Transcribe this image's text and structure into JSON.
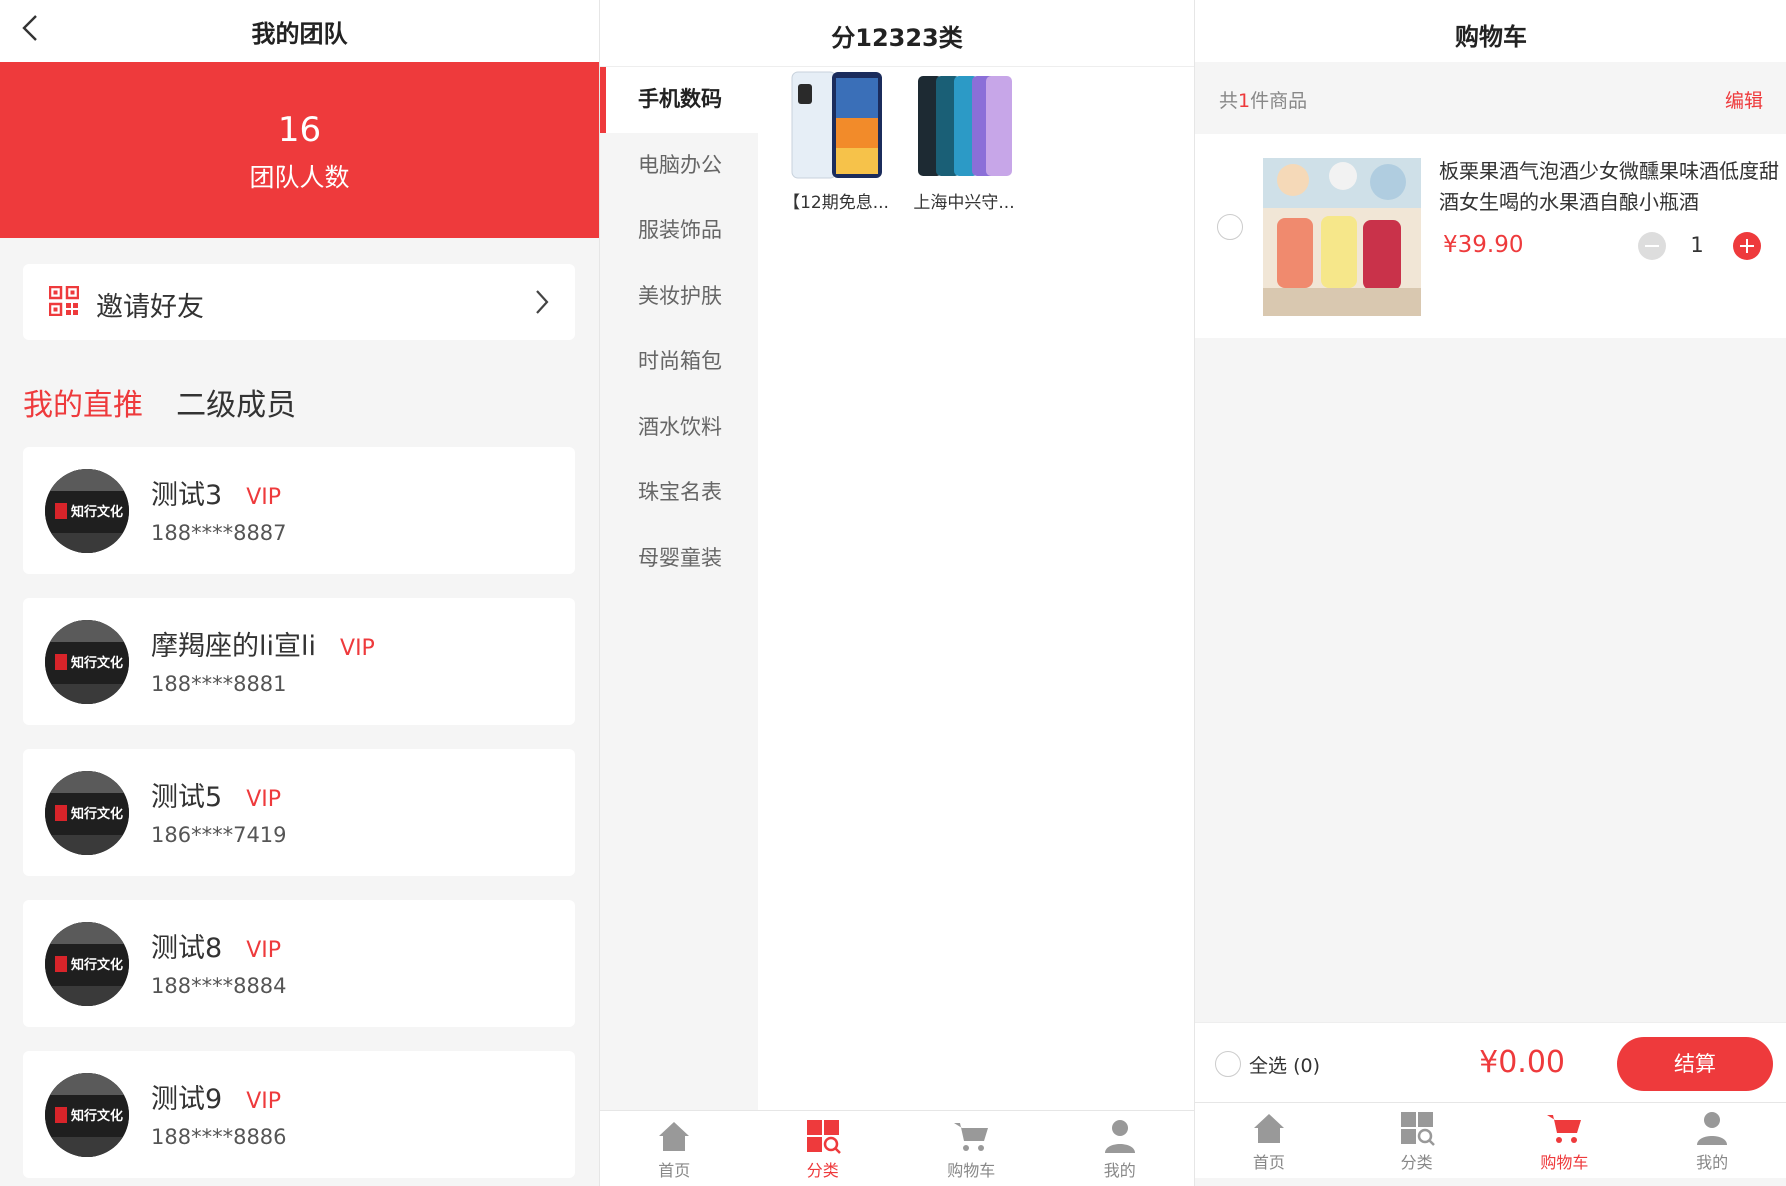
{
  "team": {
    "title": "我的团队",
    "count": "16",
    "count_label": "团队人数",
    "invite_label": "邀请好友",
    "tabs": [
      {
        "label": "我的直推",
        "active": true
      },
      {
        "label": "二级成员",
        "active": false
      }
    ],
    "vip_label": "VIP",
    "avatar_text": "知行文化",
    "members": [
      {
        "name": "测试3",
        "phone": "188****8887"
      },
      {
        "name": "摩羯座的li宣li",
        "phone": "188****8881"
      },
      {
        "name": "测试5",
        "phone": "186****7419"
      },
      {
        "name": "测试8",
        "phone": "188****8884"
      },
      {
        "name": "测试9",
        "phone": "188****8886"
      }
    ]
  },
  "category": {
    "title": "分12323类",
    "items": [
      "手机数码",
      "电脑办公",
      "服装饰品",
      "美妆护肤",
      "时尚箱包",
      "酒水饮料",
      "珠宝名表",
      "母婴童装"
    ],
    "active_index": 0,
    "products": [
      {
        "name": "【12期免息..."
      },
      {
        "name": "上海中兴守..."
      }
    ]
  },
  "cart": {
    "title": "购物车",
    "count_prefix": "共",
    "count": "1",
    "count_suffix": "件商品",
    "edit_label": "编辑",
    "item": {
      "name": "板栗果酒气泡酒少女微醺果味酒低度甜酒女生喝的水果酒自酿小瓶酒",
      "price": "¥39.90",
      "quantity": "1"
    },
    "select_all_label": "全选",
    "selected_count": "(0)",
    "total": "¥0.00",
    "checkout_label": "结算"
  },
  "tabbar": {
    "home": "首页",
    "category": "分类",
    "cart": "购物车",
    "mine": "我的"
  },
  "colors": {
    "accent": "#ee3a3c",
    "background": "#f5f5f5",
    "muted_text": "#888888"
  },
  "icons": [
    "back-icon",
    "qr-code-icon",
    "chevron-right-icon",
    "home-icon",
    "category-icon",
    "cart-icon",
    "user-icon",
    "minus-icon",
    "plus-icon"
  ]
}
